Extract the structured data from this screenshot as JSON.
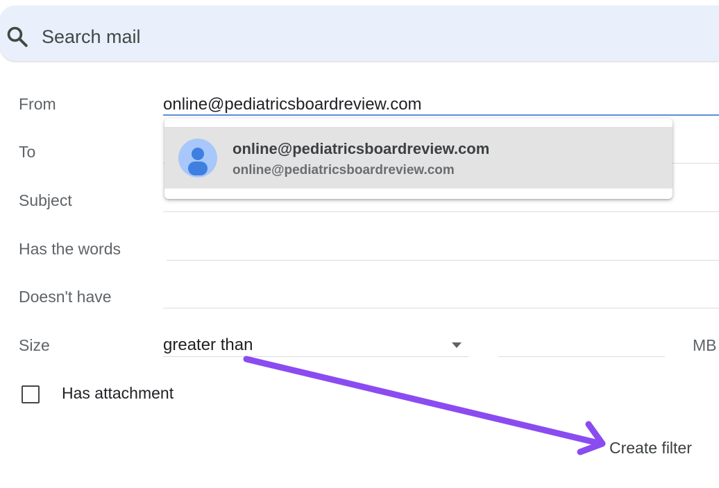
{
  "search": {
    "placeholder": "Search mail",
    "icon": "search-icon"
  },
  "filter_form": {
    "from": {
      "label": "From",
      "value": "online@pediatricsboardreview.com"
    },
    "to": {
      "label": "To",
      "value": ""
    },
    "subject": {
      "label": "Subject",
      "value": ""
    },
    "has_words": {
      "label": "Has the words",
      "value": ""
    },
    "doesnt_have": {
      "label": "Doesn't have",
      "value": ""
    },
    "size": {
      "label": "Size",
      "operator": "greater than",
      "value": "",
      "unit": "MB"
    },
    "has_attachment": {
      "label": "Has attachment",
      "checked": false
    },
    "create_filter_label": "Create filter"
  },
  "autocomplete": {
    "items": [
      {
        "name": "online@pediatricsboardreview.com",
        "email": "online@pediatricsboardreview.com",
        "icon": "person-avatar-icon"
      }
    ]
  },
  "colors": {
    "search_bar_bg": "#e9f0fb",
    "focus_underline": "#5b8fd6",
    "suggestion_highlight": "#e3e3e3",
    "avatar_bg": "#a8c7fa",
    "avatar_figure": "#3f7fe0",
    "annotation_arrow": "#8a4cf0"
  }
}
